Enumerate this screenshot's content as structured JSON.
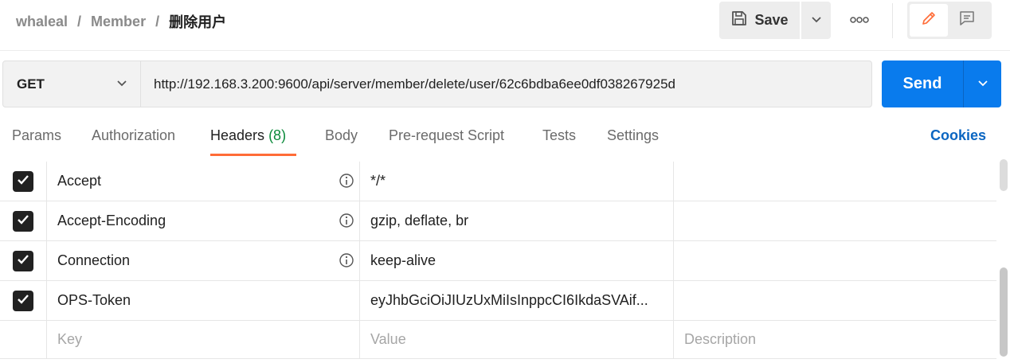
{
  "breadcrumb": {
    "workspace": "whaleal",
    "collection": "Member",
    "separator": "/",
    "request": "删除用户"
  },
  "toolbar": {
    "save_label": "Save",
    "save_icon": "save-icon",
    "more_icon": "more-horizontal-icon",
    "edit_icon": "pencil-icon",
    "comment_icon": "comment-icon"
  },
  "request": {
    "method": "GET",
    "url": "http://192.168.3.200:9600/api/server/member/delete/user/62c6bdba6ee0df038267925d",
    "send_label": "Send"
  },
  "tabs": {
    "params": "Params",
    "authorization": "Authorization",
    "headers": "Headers",
    "headers_count": "(8)",
    "body": "Body",
    "prerequest": "Pre-request Script",
    "tests": "Tests",
    "settings": "Settings",
    "cookies": "Cookies"
  },
  "headers": {
    "rows": [
      {
        "key": "Accept",
        "value": "*/*",
        "description": "",
        "checked": true,
        "info": true
      },
      {
        "key": "Accept-Encoding",
        "value": "gzip, deflate, br",
        "description": "",
        "checked": true,
        "info": true
      },
      {
        "key": "Connection",
        "value": "keep-alive",
        "description": "",
        "checked": true,
        "info": true
      },
      {
        "key": "OPS-Token",
        "value": "eyJhbGciOiJIUzUxMiIsInppcCI6IkdaSVAif...",
        "description": "",
        "checked": true,
        "info": false
      }
    ],
    "placeholders": {
      "key": "Key",
      "value": "Value",
      "description": "Description"
    }
  },
  "colors": {
    "send": "#097bed",
    "tab_underline": "#ff6c37",
    "count": "#0a8a3a",
    "cookies": "#0b66c2",
    "edit_icon": "#ff6c37"
  }
}
